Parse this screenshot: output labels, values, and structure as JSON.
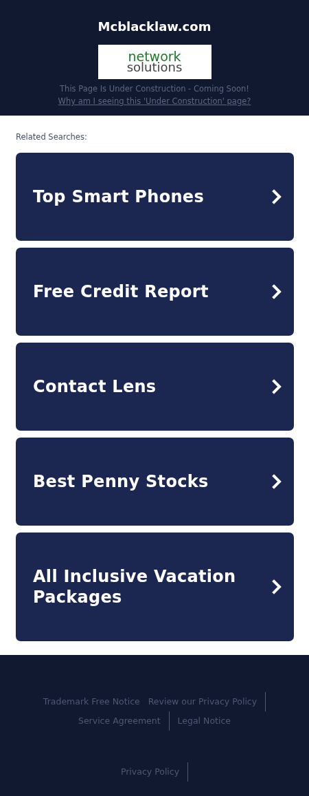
{
  "header": {
    "title": "Mcblacklaw.com",
    "logo": {
      "line_1": "network",
      "line_2": "solutions"
    },
    "notice": "This Page Is Under Construction - Coming Soon!",
    "why_link": "Why am I seeing this 'Under Construction' page?"
  },
  "related": {
    "heading": "Related Searches:",
    "items": [
      {
        "label": "Top Smart Phones"
      },
      {
        "label": "Free Credit Report"
      },
      {
        "label": "Contact Lens"
      },
      {
        "label": "Best Penny Stocks"
      },
      {
        "label": "All Inclusive Vacation Packages"
      }
    ]
  },
  "footer": {
    "links": [
      {
        "label": "Trademark Free Notice",
        "divider": false
      },
      {
        "label": "Review our Privacy Policy",
        "divider": true
      },
      {
        "label": "Service Agreement",
        "divider": true
      },
      {
        "label": "Legal Notice",
        "divider": false
      }
    ],
    "bottom_links": [
      {
        "label": "Privacy Policy",
        "divider": true
      }
    ]
  }
}
